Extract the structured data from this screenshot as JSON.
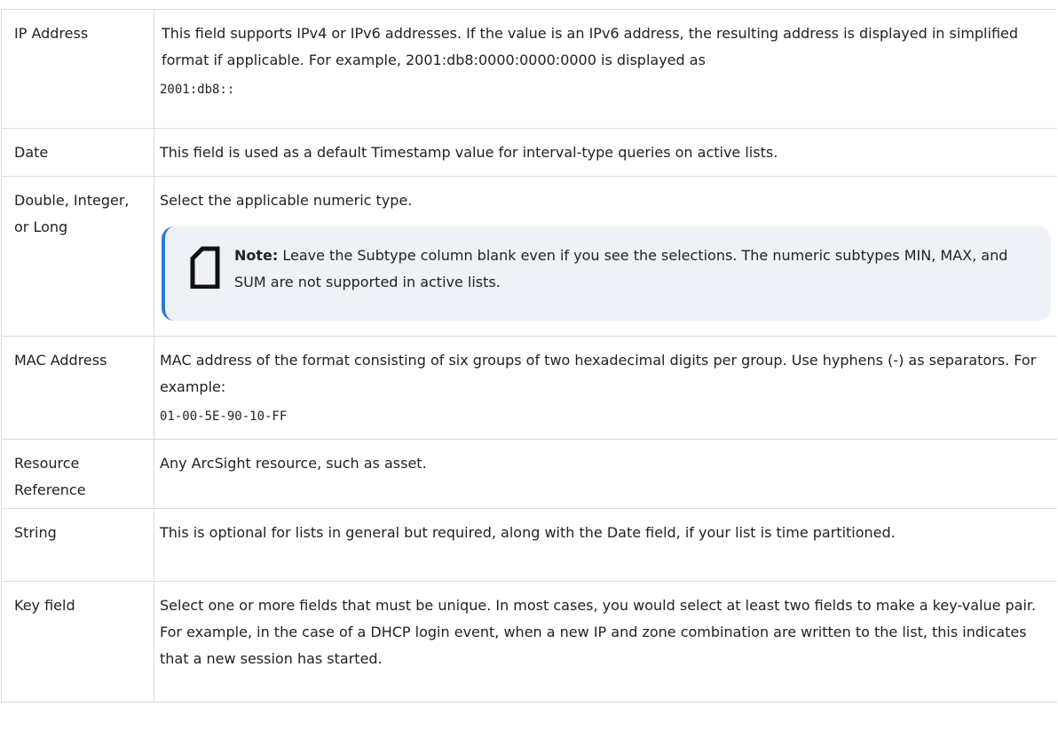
{
  "rows": [
    {
      "label": "IP Address",
      "description": "This field supports IPv4 or IPv6 addresses. If the value is an IPv6 address, the resulting address is displayed in simplified format if applicable. For example, 2001:db8:0000:0000:0000 is displayed as",
      "code": "2001:db8::"
    },
    {
      "label": "Date",
      "description": "This field is used as a default Timestamp value for interval-type queries on active lists."
    },
    {
      "label": "Double, Integer, or Long",
      "description": "Select the applicable numeric type.",
      "note": {
        "label": "Note:",
        "text": "Leave the Subtype column blank even if you see the selections. The numeric subtypes MIN, MAX, and SUM are not supported in active lists."
      }
    },
    {
      "label": "MAC Address",
      "description": "MAC address of the format consisting of six groups of two hexadecimal digits per group. Use hyphens (-) as separators. For example:",
      "code": "01-00-5E-90-10-FF"
    },
    {
      "label": "Resource Reference",
      "description": "Any ArcSight resource, such as asset."
    },
    {
      "label": "String",
      "description": "This is optional for lists in general but required, along with the Date field, if your list is time partitioned."
    },
    {
      "label": "Key field",
      "description": "Select one or more fields that must be unique. In most cases, you would select at least two fields to make a key-value pair. For example, in the case of a DHCP login event, when a new IP and zone combination are written to the list, this indicates that a new session has started."
    }
  ],
  "colors": {
    "border": "#dcdcdc",
    "note_bg": "#eef2f6",
    "note_accent": "#2b7bd3",
    "text": "#222222"
  },
  "icons": {
    "note": "note-page-icon"
  }
}
